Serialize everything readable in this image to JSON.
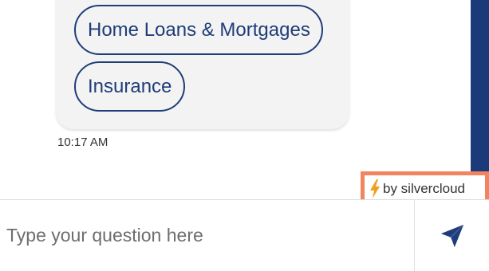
{
  "quick_replies": [
    {
      "label": "Home Loans & Mortgages"
    },
    {
      "label": "Insurance"
    }
  ],
  "message": {
    "timestamp": "10:17 AM"
  },
  "branding": {
    "text": "by silvercloud",
    "icon": "lightning-bolt-icon",
    "accent": "#f2855f",
    "bolt_color": "#f0a020"
  },
  "composer": {
    "placeholder": "Type your question here",
    "value": "",
    "send_icon": "paper-plane-icon"
  },
  "colors": {
    "brand": "#1f3d78",
    "scrollbar": "#1b3a7a",
    "bubble": "#f3f3f3"
  }
}
